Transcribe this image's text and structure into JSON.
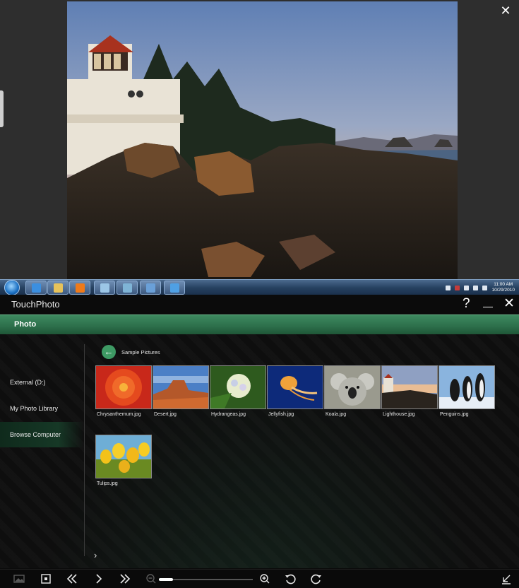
{
  "viewer": {
    "close_label": "✕"
  },
  "taskbar": {
    "pinned": [
      {
        "name": "internet-explorer",
        "color": "#3b8fe0"
      },
      {
        "name": "explorer-folder",
        "color": "#e6c25a"
      },
      {
        "name": "media-player",
        "color": "#ef7a1a"
      },
      {
        "name": "pen-app",
        "color": "#9cc6e6"
      },
      {
        "name": "dvd-app",
        "color": "#7fb4d6"
      },
      {
        "name": "pencil-app",
        "color": "#6aa0d8"
      },
      {
        "name": "touchphoto-app",
        "color": "#4fa0e4"
      }
    ],
    "time": "11:00 AM",
    "date": "10/29/2010"
  },
  "app": {
    "title": "TouchPhoto",
    "help_label": "?",
    "minimize_label": "—",
    "close_label": "✕",
    "section": "Photo"
  },
  "nav": {
    "items": [
      {
        "label": "External (D:)",
        "active": false
      },
      {
        "label": "My Photo Library",
        "active": false
      },
      {
        "label": "Browse Computer",
        "active": true
      }
    ]
  },
  "browser": {
    "back_label": "←",
    "path": "Sample Pictures",
    "files": [
      {
        "name": "Chrysanthemum.jpg",
        "icon": "chrysanthemum-thumb"
      },
      {
        "name": "Desert.jpg",
        "icon": "desert-thumb"
      },
      {
        "name": "Hydrangeas.jpg",
        "icon": "hydrangeas-thumb"
      },
      {
        "name": "Jellyfish.jpg",
        "icon": "jellyfish-thumb"
      },
      {
        "name": "Koala.jpg",
        "icon": "koala-thumb"
      },
      {
        "name": "Lighthouse.jpg",
        "icon": "lighthouse-thumb"
      },
      {
        "name": "Penguins.jpg",
        "icon": "penguins-thumb"
      },
      {
        "name": "Tulips.jpg",
        "icon": "tulips-thumb"
      }
    ],
    "expand_label": "›"
  },
  "toolbar": {
    "zoom_level": 0.15
  },
  "colors": {
    "accent": "#2c6e4a",
    "back_button": "#3e9a64"
  }
}
